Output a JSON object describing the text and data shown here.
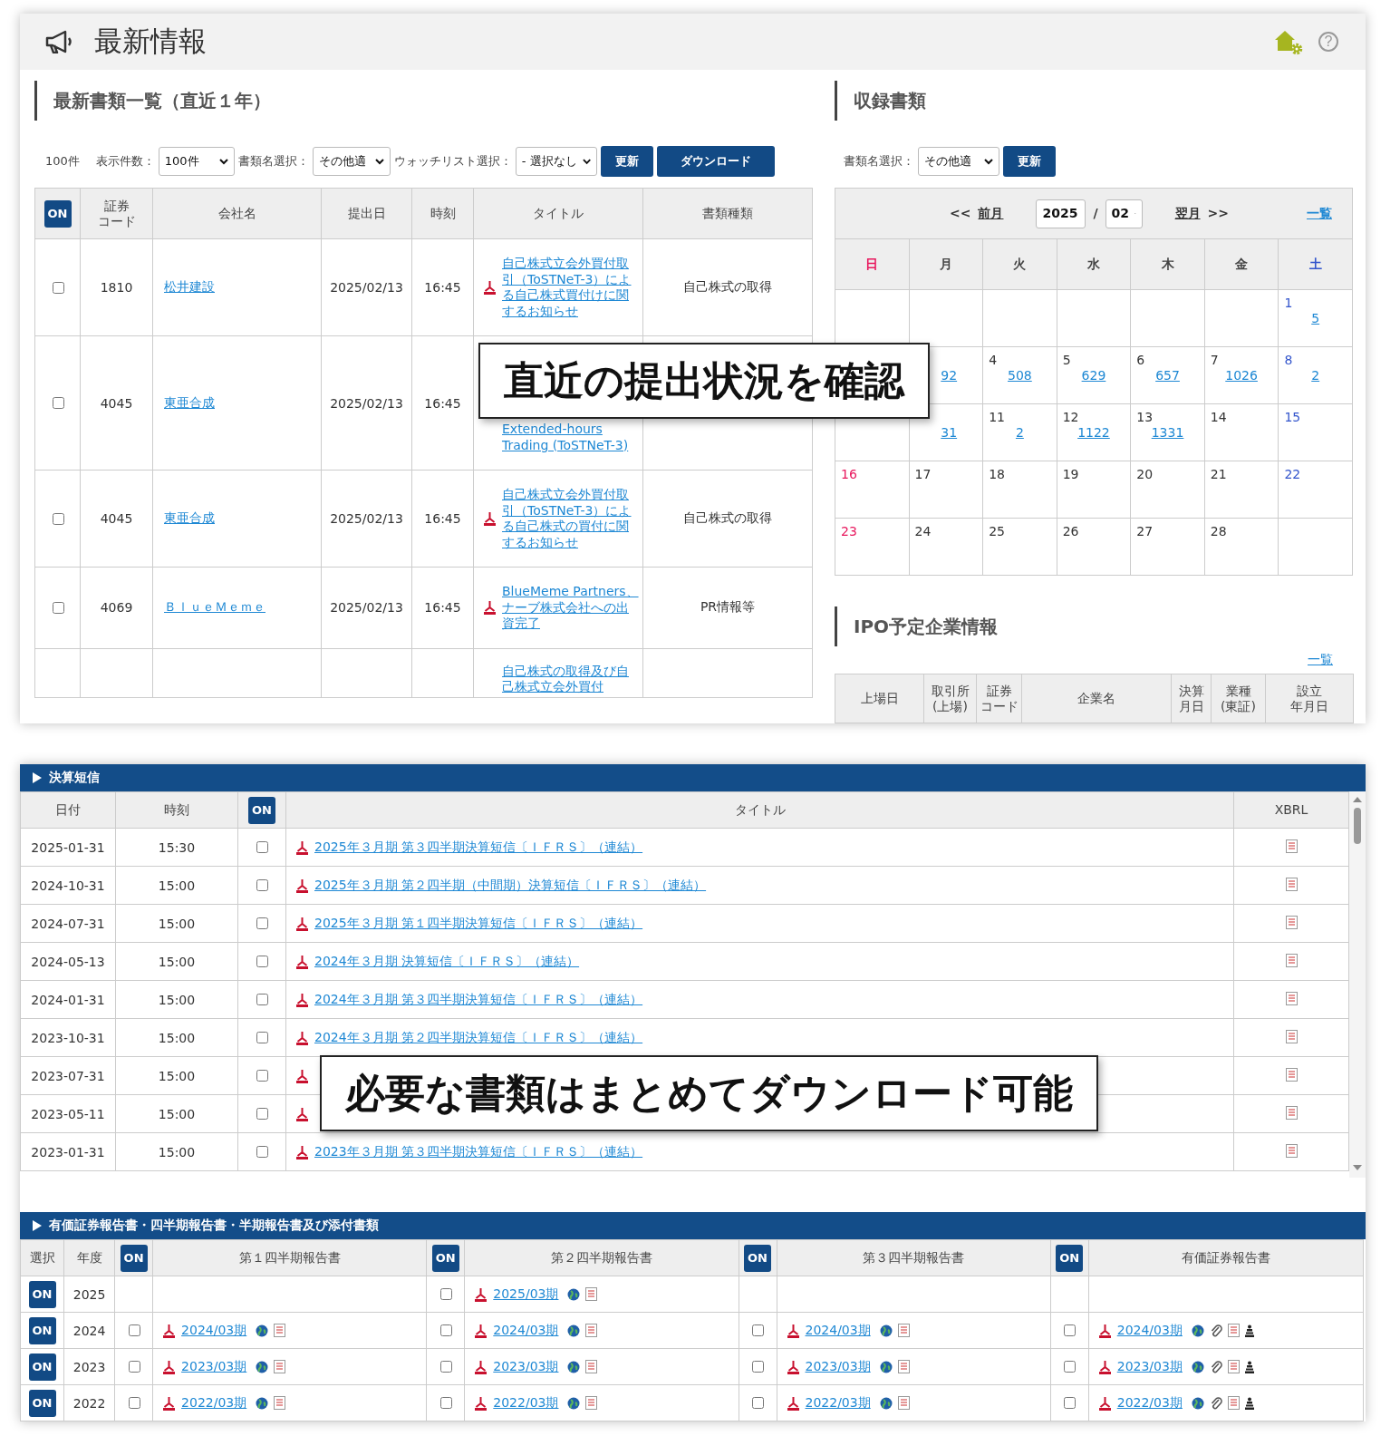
{
  "header": {
    "title": "最新情報",
    "help": "?"
  },
  "latest": {
    "title": "最新書類一覧（直近１年）",
    "count": "100件",
    "filters": [
      {
        "label": "表示件数：",
        "value": "100件"
      },
      {
        "label": "書類名選択：",
        "value": "その他適"
      },
      {
        "label": "ウォッチリスト選択：",
        "value": "- 選択なし"
      }
    ],
    "buttons": [
      "更新",
      "ダウンロード"
    ],
    "columns": [
      "ON",
      [
        "証券",
        "コード"
      ],
      "会社名",
      "提出日",
      "時刻",
      "タイトル",
      "書類種類"
    ],
    "rows": [
      {
        "kind": "doc",
        "checked": false,
        "code": "1810",
        "company": "松井建設",
        "date": "2025/02/13",
        "time": "16:45",
        "title": "自己株式立会外買付取引（ToSTNeT-3）による自己株式買付けに関するお知らせ",
        "doc_type": "自己株式の取得"
      },
      {
        "kind": "covered",
        "checked": false,
        "code": "4045",
        "company": "東亜合成",
        "date": "2025/02/13",
        "time": "16:45",
        "title": "Extended-hours Trading (ToSTNeT-3)"
      },
      {
        "kind": "doc",
        "checked": false,
        "code": "4045",
        "company": "東亜合成",
        "date": "2025/02/13",
        "time": "16:45",
        "title": "自己株式立会外買付取引（ToSTNeT-3）による自己株式の買付に関するお知らせ",
        "doc_type": "自己株式の取得"
      },
      {
        "kind": "doc",
        "checked": false,
        "code": "4069",
        "company": "ＢｌｕｅＭｅｍｅ",
        "date": "2025/02/13",
        "time": "16:45",
        "title": "BlueMeme Partners、ナーブ株式会社への出資完了",
        "doc_type": "PR情報等"
      },
      {
        "kind": "cut",
        "title": "自己株式の取得及び自己株式立会外買付"
      }
    ]
  },
  "library": {
    "title": "収録書類",
    "filter": {
      "label": "書類名選択：",
      "value": "その他適"
    },
    "button": "更新",
    "calendar": {
      "prev": "<<",
      "prev_link": "前月",
      "year": "2025",
      "sep": "/",
      "month": "02",
      "next_link": "翌月",
      "next": ">>",
      "list_link": "一覧",
      "weekdays": [
        "日",
        "月",
        "火",
        "水",
        "木",
        "金",
        "土"
      ],
      "weeks": [
        [
          {
            "kind": "empty"
          },
          {
            "kind": "empty"
          },
          {
            "kind": "empty"
          },
          {
            "kind": "empty"
          },
          {
            "kind": "empty"
          },
          {
            "kind": "empty"
          },
          {
            "kind": "day",
            "day": "1",
            "count": "5"
          }
        ],
        [
          {
            "kind": "empty"
          },
          {
            "kind": "day",
            "count": "92"
          },
          {
            "kind": "day",
            "day": "4",
            "count": "508"
          },
          {
            "kind": "day",
            "day": "5",
            "count": "629"
          },
          {
            "kind": "day",
            "day": "6",
            "count": "657"
          },
          {
            "kind": "day",
            "day": "7",
            "count": "1026"
          },
          {
            "kind": "day",
            "day": "8",
            "count": "2"
          }
        ],
        [
          {
            "kind": "empty"
          },
          {
            "kind": "day",
            "count": "31"
          },
          {
            "kind": "day",
            "day": "11",
            "count": "2"
          },
          {
            "kind": "day",
            "day": "12",
            "count": "1122"
          },
          {
            "kind": "day",
            "day": "13",
            "count": "1331"
          },
          {
            "kind": "day",
            "day": "14"
          },
          {
            "kind": "day",
            "day": "15"
          }
        ],
        [
          {
            "kind": "day",
            "day": "16"
          },
          {
            "kind": "day",
            "day": "17"
          },
          {
            "kind": "day",
            "day": "18"
          },
          {
            "kind": "day",
            "day": "19"
          },
          {
            "kind": "day",
            "day": "20"
          },
          {
            "kind": "day",
            "day": "21"
          },
          {
            "kind": "day",
            "day": "22"
          }
        ],
        [
          {
            "kind": "day",
            "day": "23"
          },
          {
            "kind": "day",
            "day": "24"
          },
          {
            "kind": "day",
            "day": "25"
          },
          {
            "kind": "day",
            "day": "26"
          },
          {
            "kind": "day",
            "day": "27"
          },
          {
            "kind": "day",
            "day": "28"
          },
          {
            "kind": "empty"
          }
        ]
      ]
    }
  },
  "ipo": {
    "title": "IPO予定企業情報",
    "list_link": "一覧",
    "columns": [
      "上場日",
      [
        "取引所",
        "(上場)"
      ],
      [
        "証券",
        "コード"
      ],
      "企業名",
      [
        "決算",
        "月日"
      ],
      [
        "業種",
        "(東証)"
      ],
      [
        "設立",
        "年月日"
      ]
    ]
  },
  "callout_top": "直近の提出状況を確認",
  "tanshin": {
    "title": "決算短信",
    "columns": [
      "日付",
      "時刻",
      "ON",
      "タイトル",
      "XBRL"
    ],
    "rows": [
      {
        "date": "2025-01-31",
        "time": "15:30",
        "checked": false,
        "title": "2025年３月期 第３四半期決算短信〔ＩＦＲＳ〕（連結）"
      },
      {
        "date": "2024-10-31",
        "time": "15:00",
        "checked": false,
        "title": "2025年３月期 第２四半期（中間期）決算短信〔ＩＦＲＳ〕（連結）"
      },
      {
        "date": "2024-07-31",
        "time": "15:00",
        "checked": false,
        "title": "2025年３月期 第１四半期決算短信〔ＩＦＲＳ〕（連結）"
      },
      {
        "date": "2024-05-13",
        "time": "15:00",
        "checked": false,
        "title": "2024年３月期 決算短信〔ＩＦＲＳ〕（連結）"
      },
      {
        "date": "2024-01-31",
        "time": "15:00",
        "checked": false,
        "title": "2024年３月期 第３四半期決算短信〔ＩＦＲＳ〕（連結）"
      },
      {
        "date": "2023-10-31",
        "time": "15:00",
        "checked": false,
        "title": "2024年３月期 第２四半期決算短信〔ＩＦＲＳ〕（連結）"
      },
      {
        "date": "2023-07-31",
        "time": "15:00",
        "checked": false
      },
      {
        "date": "2023-05-11",
        "time": "15:00",
        "checked": false
      },
      {
        "date": "2023-01-31",
        "time": "15:00",
        "checked": false,
        "title": "2023年３月期 第３四半期決算短信〔ＩＦＲＳ〕（連結）"
      }
    ]
  },
  "callout_bottom": "必要な書類はまとめてダウンロード可能",
  "reports": {
    "title": "有価証券報告書・四半期報告書・半期報告書及び添付書類",
    "columns": [
      "選択",
      "年度",
      "ON",
      "第１四半期報告書",
      "ON",
      "第２四半期報告書",
      "ON",
      "第３四半期報告書",
      "ON",
      "有価証券報告書"
    ],
    "rows": [
      {
        "select": "ON",
        "year": "2025",
        "docs": [
          {
            "kind": "none"
          },
          {
            "kind": "quarterly",
            "checked": false,
            "period": "2025/03期"
          },
          {
            "kind": "none"
          },
          {
            "kind": "none"
          }
        ]
      },
      {
        "select": "ON",
        "year": "2024",
        "docs": [
          {
            "kind": "quarterly",
            "checked": false,
            "period": "2024/03期"
          },
          {
            "kind": "quarterly",
            "checked": false,
            "period": "2024/03期"
          },
          {
            "kind": "quarterly",
            "checked": false,
            "period": "2024/03期"
          },
          {
            "kind": "annual",
            "checked": false,
            "period": "2024/03期"
          }
        ]
      },
      {
        "select": "ON",
        "year": "2023",
        "docs": [
          {
            "kind": "quarterly",
            "checked": false,
            "period": "2023/03期"
          },
          {
            "kind": "quarterly",
            "checked": false,
            "period": "2023/03期"
          },
          {
            "kind": "quarterly",
            "checked": false,
            "period": "2023/03期"
          },
          {
            "kind": "annual",
            "checked": false,
            "period": "2023/03期"
          }
        ]
      },
      {
        "select": "ON",
        "year": "2022",
        "docs": [
          {
            "kind": "quarterly",
            "checked": false,
            "period": "2022/03期"
          },
          {
            "kind": "quarterly",
            "checked": false,
            "period": "2022/03期"
          },
          {
            "kind": "quarterly",
            "checked": false,
            "period": "2022/03期"
          },
          {
            "kind": "annual",
            "checked": false,
            "period": "2022/03期"
          }
        ]
      }
    ]
  }
}
